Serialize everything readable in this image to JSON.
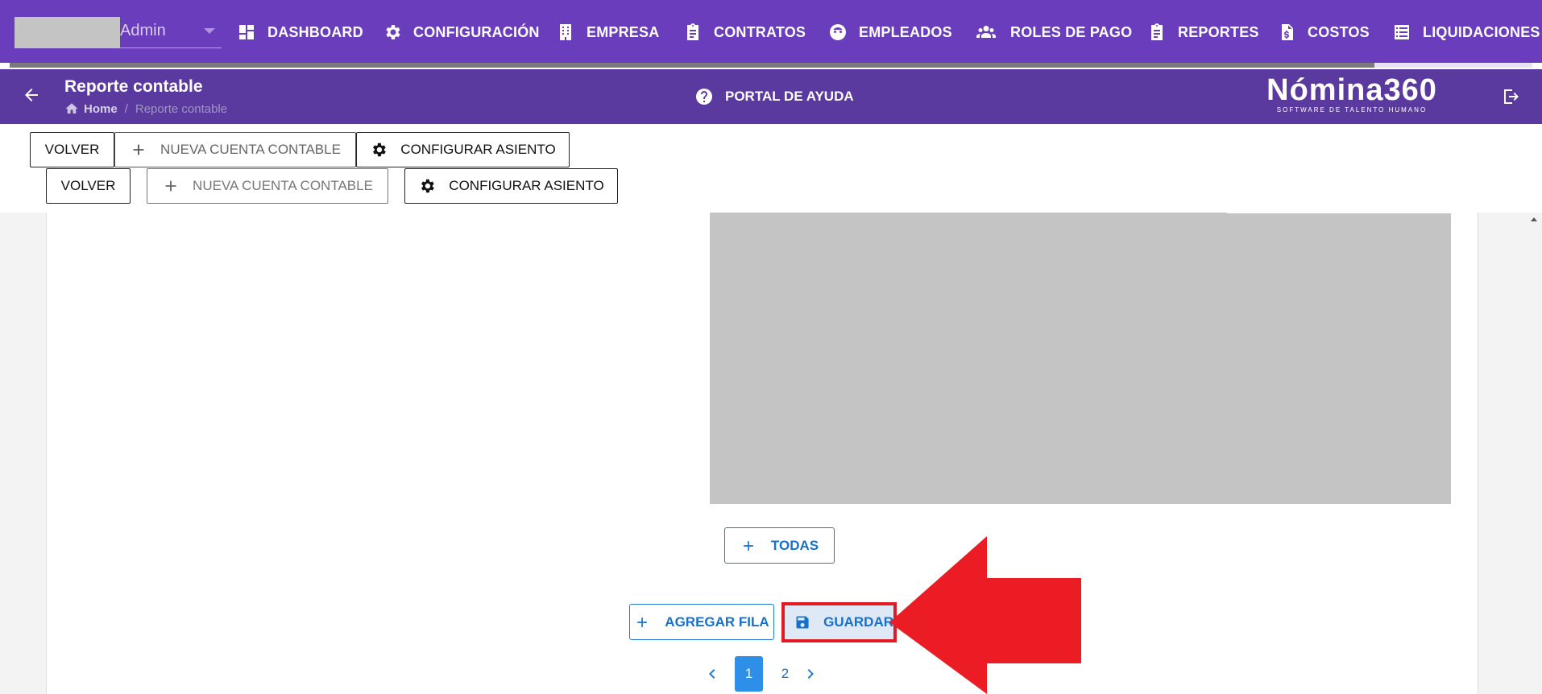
{
  "topnav": {
    "user": {
      "name": "Admin"
    },
    "items": [
      {
        "label": "DASHBOARD",
        "icon": "dashboard-icon"
      },
      {
        "label": "CONFIGURACIÓN",
        "icon": "gear-icon"
      },
      {
        "label": "EMPRESA",
        "icon": "building-icon"
      },
      {
        "label": "CONTRATOS",
        "icon": "clipboard-icon"
      },
      {
        "label": "EMPLEADOS",
        "icon": "face-icon"
      },
      {
        "label": "ROLES DE PAGO",
        "icon": "people-icon"
      },
      {
        "label": "REPORTES",
        "icon": "clipboard-icon"
      },
      {
        "label": "COSTOS",
        "icon": "cost-document-icon"
      },
      {
        "label": "LIQUIDACIONES",
        "icon": "list-icon"
      }
    ]
  },
  "header": {
    "title": "Reporte contable",
    "breadcrumb": {
      "home": "Home",
      "separator": "/",
      "current": "Reporte contable"
    },
    "help_label": "PORTAL DE AYUDA",
    "logo": {
      "main": "Nómina360",
      "sub": "SOFTWARE DE TALENTO HUMANO"
    }
  },
  "toolbar": {
    "back_label": "VOLVER",
    "new_account_label": "NUEVA CUENTA CONTABLE",
    "configure_label": "CONFIGURAR ASIENTO"
  },
  "content": {
    "all_label": "TODAS",
    "add_row_label": "AGREGAR FILA",
    "save_label": "GUARDAR"
  },
  "pagination": {
    "pages": [
      "1",
      "2"
    ],
    "current": "1"
  },
  "colors": {
    "nav_bg": "#6a3dbd",
    "header_bg": "#5b3aa0",
    "accent": "#1671cc",
    "highlight": "#e01b23"
  }
}
